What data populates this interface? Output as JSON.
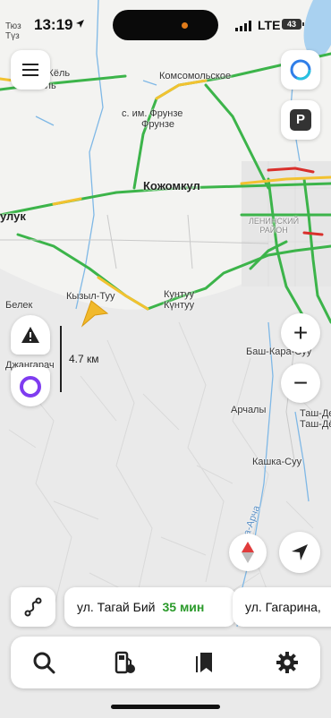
{
  "status_bar": {
    "time": "13:19",
    "network": "LTE",
    "battery": "43"
  },
  "corner_label": [
    "Тюз",
    "Түз"
  ],
  "places": {
    "kel": "с. им. Кёль",
    "kel2": "Кёль",
    "komsomolskoe": "Комсомольское",
    "frunze1": "с. им. Фрунзе",
    "frunze2": "Фрунзе",
    "kozhomkul": "Кожомкул",
    "lukin": "улук",
    "lenin_district": "ЛЕНИНСКИЙ\nРАЙОН",
    "belek": "Белек",
    "kyzyl_tuu": "Кызыл-Туу",
    "kuntuu1": "Кунтуу",
    "kuntuu2": "Күнтуу",
    "dzhangarach": "Джангарач",
    "bash_kara": "Баш-Кара-Суу",
    "archaly": "Арчалы",
    "tash_dobo1": "Таш-Де",
    "tash_dobo2": "Таш-Дё",
    "kashka_suu": "Кашка-Суу",
    "ala_archa": "Ала-Арча"
  },
  "scale_label": "4.7 км",
  "route_chips": [
    {
      "street": "ул. Тагай Бий",
      "eta": "35 мин"
    },
    {
      "street": "ул. Гагарина,",
      "eta": ""
    }
  ],
  "buttons": {
    "menu": "menu-icon",
    "alice": "alice-icon",
    "parking": "P",
    "zoom_in": "+",
    "zoom_out": "−",
    "warning": "warning-icon",
    "compass": "compass-icon",
    "locate": "locate-icon",
    "route": "route-icon"
  },
  "bottom_tabs": [
    "search-icon",
    "fuel-icon",
    "bookmarks-icon",
    "settings-icon"
  ],
  "colors": {
    "traffic_green": "#3cb44a",
    "traffic_yellow": "#f2c230",
    "traffic_red": "#d9302c",
    "user_arrow": "#f1b92b",
    "alice_purple": "#7f3cf0"
  }
}
